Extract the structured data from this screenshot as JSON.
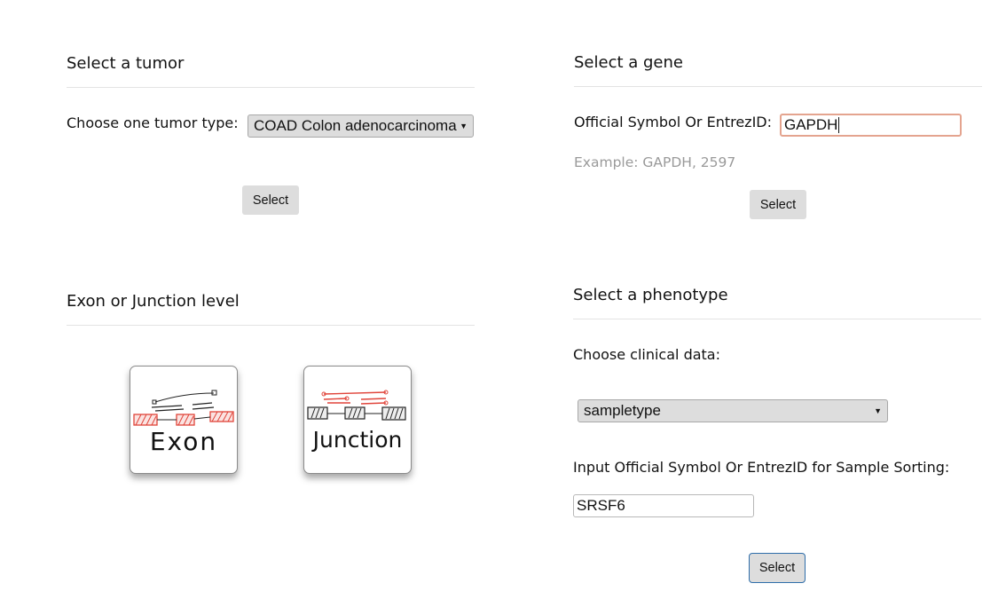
{
  "tumor_panel": {
    "heading": "Select a tumor",
    "choose_label": "Choose one tumor type:",
    "tumor_select_value": "COAD Colon adenocarcinoma",
    "select_button": "Select"
  },
  "gene_panel": {
    "heading": "Select a gene",
    "symbol_label": "Official Symbol Or EntrezID:",
    "symbol_value": "GAPDH",
    "example_hint": "Example: GAPDH, 2597",
    "select_button": "Select"
  },
  "level_panel": {
    "heading": "Exon or Junction level",
    "options": [
      {
        "label": "Exon",
        "icon": "exon-sketch-icon"
      },
      {
        "label": "Junction",
        "icon": "junction-sketch-icon"
      }
    ]
  },
  "phenotype_panel": {
    "heading": "Select a phenotype",
    "clinical_label": "Choose clinical data:",
    "clinical_select_value": "sampletype",
    "sorting_label": "Input Official Symbol Or EntrezID for Sample Sorting:",
    "sorting_value": "SRSF6",
    "select_button": "Select"
  },
  "colors": {
    "sketch_red": "#e0443a",
    "focus_blue": "#2f6eaa",
    "active_input_border": "#e4a48f"
  }
}
